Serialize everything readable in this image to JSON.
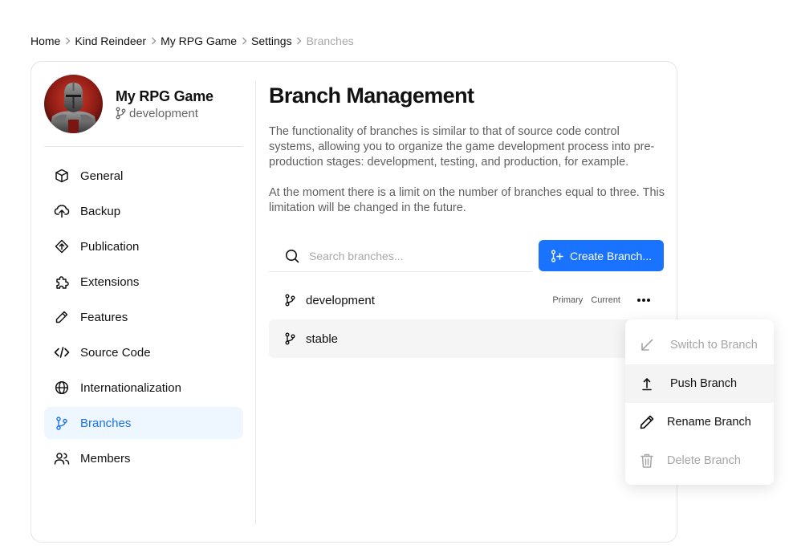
{
  "breadcrumb": [
    {
      "label": "Home"
    },
    {
      "label": "Kind Reindeer"
    },
    {
      "label": "My RPG Game"
    },
    {
      "label": "Settings"
    },
    {
      "label": "Branches"
    }
  ],
  "project": {
    "name": "My RPG Game",
    "branch": "development"
  },
  "sidebar": {
    "items": [
      {
        "label": "General",
        "icon": "cube-icon"
      },
      {
        "label": "Backup",
        "icon": "cloud-upload-icon"
      },
      {
        "label": "Publication",
        "icon": "diamond-arrow-icon"
      },
      {
        "label": "Extensions",
        "icon": "puzzle-icon"
      },
      {
        "label": "Features",
        "icon": "pen-icon"
      },
      {
        "label": "Source Code",
        "icon": "code-icon"
      },
      {
        "label": "Internationalization",
        "icon": "globe-icon"
      },
      {
        "label": "Branches",
        "icon": "branch-icon",
        "active": true
      },
      {
        "label": "Members",
        "icon": "users-icon"
      }
    ]
  },
  "main": {
    "title": "Branch Management",
    "description_1": "The functionality of branches is similar to that of source code control systems, allowing you to organize the game development process into pre-production stages: development, testing, and production, for example.",
    "description_2": "At the moment there is a limit on the number of branches equal to three. This limitation will be changed in the future.",
    "search": {
      "placeholder": "Search branches...",
      "value": ""
    },
    "create_button": "Create Branch..."
  },
  "branches": [
    {
      "name": "development",
      "tags": [
        "Primary",
        "Current"
      ]
    },
    {
      "name": "stable",
      "tags": []
    }
  ],
  "context_menu": {
    "items": [
      {
        "label": "Switch to Branch",
        "icon": "arrow-down-left-icon",
        "disabled": true
      },
      {
        "label": "Push Branch",
        "icon": "push-up-icon",
        "disabled": false
      },
      {
        "label": "Rename Branch",
        "icon": "pencil-icon",
        "disabled": false
      },
      {
        "label": "Delete Branch",
        "icon": "trash-icon",
        "disabled": true
      }
    ]
  },
  "colors": {
    "accent": "#1a73ff",
    "active_bg": "#eef6ff",
    "active_text": "#1a73e8"
  }
}
